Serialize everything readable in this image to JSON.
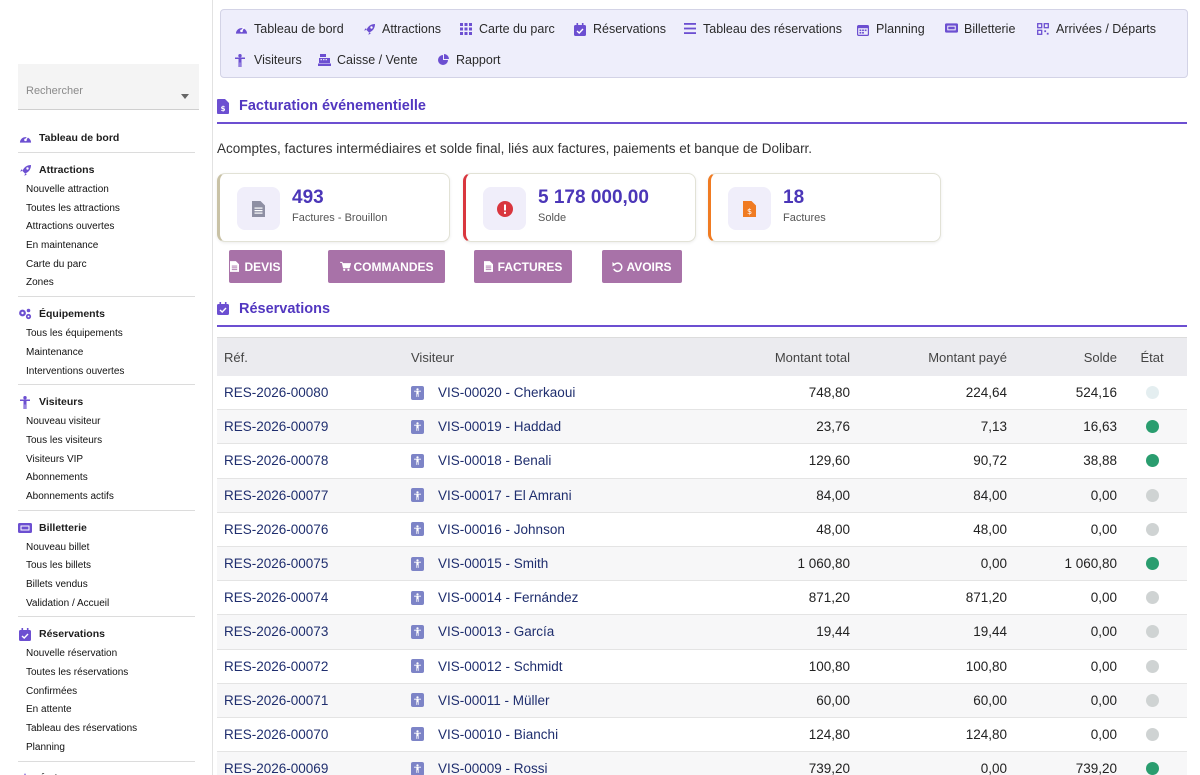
{
  "sidebar": {
    "search_placeholder": "Rechercher",
    "sections": [
      {
        "title": "Tableau de bord",
        "icon": "dashboard-icon",
        "items": []
      },
      {
        "title": "Attractions",
        "icon": "rocket-icon",
        "items": [
          "Nouvelle attraction",
          "Toutes les attractions",
          "Attractions ouvertes",
          "En maintenance",
          "Carte du parc",
          "Zones"
        ]
      },
      {
        "title": "Équipements",
        "icon": "gears-icon",
        "items": [
          "Tous les équipements",
          "Maintenance",
          "Interventions ouvertes"
        ]
      },
      {
        "title": "Visiteurs",
        "icon": "person-icon",
        "items": [
          "Nouveau visiteur",
          "Tous les visiteurs",
          "Visiteurs VIP",
          "Abonnements",
          "Abonnements actifs"
        ]
      },
      {
        "title": "Billetterie",
        "icon": "ticket-icon",
        "items": [
          "Nouveau billet",
          "Tous les billets",
          "Billets vendus",
          "Validation / Accueil"
        ]
      },
      {
        "title": "Réservations",
        "icon": "calendar-check-icon",
        "items": [
          "Nouvelle réservation",
          "Toutes les réservations",
          "Confirmées",
          "En attente",
          "Tableau des réservations",
          "Planning"
        ]
      },
      {
        "title": "Événements",
        "icon": "star-icon",
        "items": []
      }
    ]
  },
  "topnav": [
    {
      "label": "Tableau de bord",
      "icon": "dashboard-icon"
    },
    {
      "label": "Attractions",
      "icon": "rocket-icon"
    },
    {
      "label": "Carte du parc",
      "icon": "grid-icon"
    },
    {
      "label": "Réservations",
      "icon": "calendar-check-icon"
    },
    {
      "label": "Tableau des réservations",
      "icon": "list-icon"
    },
    {
      "label": "Planning",
      "icon": "calendar-icon"
    },
    {
      "label": "Billetterie",
      "icon": "ticket-icon"
    },
    {
      "label": "Arrivées / Départs",
      "icon": "qr-icon"
    },
    {
      "label": "Visiteurs",
      "icon": "person-icon"
    },
    {
      "label": "Caisse / Vente",
      "icon": "cash-register-icon"
    },
    {
      "label": "Rapport",
      "icon": "pie-chart-icon"
    }
  ],
  "billing": {
    "title": "Facturation événementielle",
    "description": "Acomptes, factures intermédiaires et solde final, liés aux factures, paiements et banque de Dolibarr.",
    "cards": [
      {
        "value": "493",
        "label": "Factures - Brouillon",
        "accent": "#c9c2a6",
        "icon": "document-icon"
      },
      {
        "value": "5 178 000,00",
        "label": "Solde",
        "accent": "#d9363e",
        "icon": "alert-icon"
      },
      {
        "value": "18",
        "label": "Factures",
        "accent": "#f07b22",
        "icon": "invoice-icon"
      }
    ],
    "buttons": [
      {
        "label": "DEVIS",
        "icon": "document-icon"
      },
      {
        "label": "COMMANDES",
        "icon": "cart-icon"
      },
      {
        "label": "FACTURES",
        "icon": "document-icon"
      },
      {
        "label": "AVOIRS",
        "icon": "undo-icon"
      }
    ]
  },
  "reservations": {
    "title": "Réservations",
    "columns": [
      "Réf.",
      "Visiteur",
      "Montant total",
      "Montant payé",
      "Solde",
      "État"
    ],
    "rows": [
      {
        "ref": "RES-2026-00080",
        "visitor": "VIS-00020 - Cherkaoui",
        "total": "748,80",
        "paid": "224,64",
        "balance": "524,16",
        "state": "#e4eef0"
      },
      {
        "ref": "RES-2026-00079",
        "visitor": "VIS-00019 - Haddad",
        "total": "23,76",
        "paid": "7,13",
        "balance": "16,63",
        "state": "#2a9d6f"
      },
      {
        "ref": "RES-2026-00078",
        "visitor": "VIS-00018 - Benali",
        "total": "129,60",
        "paid": "90,72",
        "balance": "38,88",
        "state": "#2a9d6f"
      },
      {
        "ref": "RES-2026-00077",
        "visitor": "VIS-00017 - El Amrani",
        "total": "84,00",
        "paid": "84,00",
        "balance": "0,00",
        "state": "#cfd3d3"
      },
      {
        "ref": "RES-2026-00076",
        "visitor": "VIS-00016 - Johnson",
        "total": "48,00",
        "paid": "48,00",
        "balance": "0,00",
        "state": "#cfd3d3"
      },
      {
        "ref": "RES-2026-00075",
        "visitor": "VIS-00015 - Smith",
        "total": "1 060,80",
        "paid": "0,00",
        "balance": "1 060,80",
        "state": "#2a9d6f"
      },
      {
        "ref": "RES-2026-00074",
        "visitor": "VIS-00014 - Fernández",
        "total": "871,20",
        "paid": "871,20",
        "balance": "0,00",
        "state": "#cfd3d3"
      },
      {
        "ref": "RES-2026-00073",
        "visitor": "VIS-00013 - García",
        "total": "19,44",
        "paid": "19,44",
        "balance": "0,00",
        "state": "#cfd3d3"
      },
      {
        "ref": "RES-2026-00072",
        "visitor": "VIS-00012 - Schmidt",
        "total": "100,80",
        "paid": "100,80",
        "balance": "0,00",
        "state": "#cfd3d3"
      },
      {
        "ref": "RES-2026-00071",
        "visitor": "VIS-00011 - Müller",
        "total": "60,00",
        "paid": "60,00",
        "balance": "0,00",
        "state": "#cfd3d3"
      },
      {
        "ref": "RES-2026-00070",
        "visitor": "VIS-00010 - Bianchi",
        "total": "124,80",
        "paid": "124,80",
        "balance": "0,00",
        "state": "#cfd3d3"
      },
      {
        "ref": "RES-2026-00069",
        "visitor": "VIS-00009 - Rossi",
        "total": "739,20",
        "paid": "0,00",
        "balance": "739,20",
        "state": "#2a9d6f"
      }
    ]
  }
}
